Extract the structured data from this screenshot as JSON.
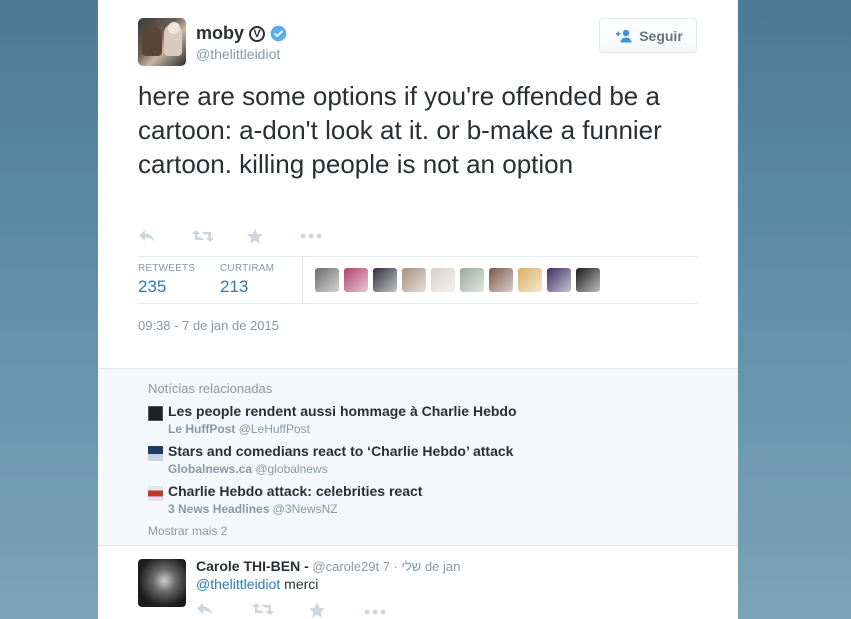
{
  "tweet": {
    "user": {
      "name": "moby",
      "handle": "@thelittleidiot",
      "verified": true
    },
    "follow_label": "Seguir",
    "text": "here are some options if you're offended be a cartoon: a-don't look at it. or b-make a funnier cartoon. killing people is not an option",
    "actions": [
      "reply-icon",
      "retweet-icon",
      "favorite-icon",
      "more-icon"
    ],
    "stats": {
      "retweets_label": "RETWEETS",
      "retweets": "235",
      "likes_label": "CURTIRAM",
      "likes": "213"
    },
    "liker_avatar_colors": [
      "#6b6b6b",
      "#b0406a",
      "#2f2f3f",
      "#a88f79",
      "#d8cfc4",
      "#9aa79a",
      "#7a5848",
      "#d8b060",
      "#3d2f66",
      "#1a1a1a"
    ],
    "timestamp": "09:38 - 7 de jan de 2015"
  },
  "related": {
    "title": "Notícias relacionadas",
    "items": [
      {
        "headline": "Les people rendent aussi hommage à Charlie Hebdo",
        "source": "Le HuffPost",
        "handle": "@LeHuffPost",
        "thumb_color": "#222222"
      },
      {
        "headline": "Stars and comedians react to ‘Charlie Hebdo’ attack",
        "source": "Globalnews.ca",
        "handle": "@globalnews",
        "thumb_color": "#1f3b66"
      },
      {
        "headline": "Charlie Hebdo attack: celebrities react",
        "source": "3 News Headlines",
        "handle": "@3NewsNZ",
        "thumb_color": "#c0392b"
      }
    ],
    "show_more": "Mostrar mais 2"
  },
  "reply": {
    "name": "Carole THI-BEN -",
    "handle": "@carole29t שלי",
    "separator": "·",
    "date": "7 de jan",
    "mention": "@thelittleidiot",
    "text": "merci"
  },
  "colors": {
    "link": "#2b7bb9",
    "verified": "#55acee",
    "muted": "#8899a6"
  }
}
